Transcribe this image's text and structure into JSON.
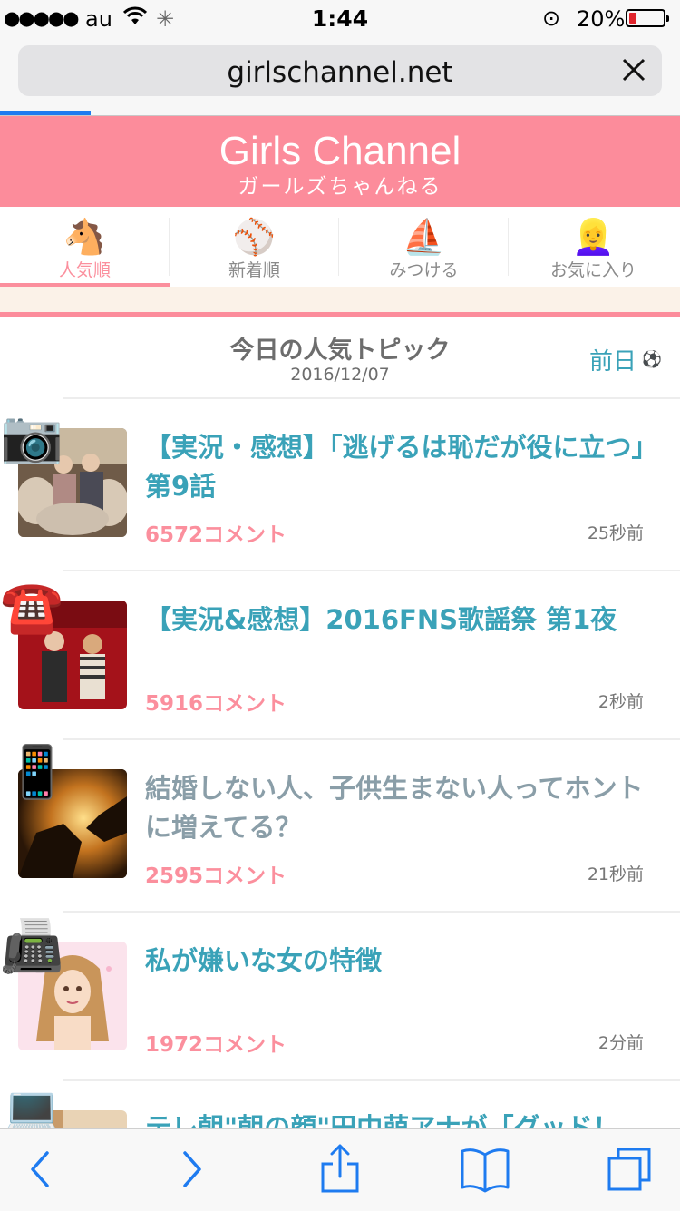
{
  "status": {
    "signal": "●●●●●",
    "carrier": "au",
    "spinner": "✳",
    "time": "1:44",
    "lock": "⊙",
    "battery": "20%"
  },
  "browser": {
    "url": "girlschannel.net"
  },
  "site": {
    "logo": "Girls Channel",
    "logo_sub": "ガールズちゃんねる",
    "brand_color": "#fc8c9b"
  },
  "tabs": [
    {
      "icon": "🐴",
      "label": "人気順",
      "active": true
    },
    {
      "icon": "⚾",
      "label": "新着順"
    },
    {
      "icon": "⛵",
      "label": "みつける"
    },
    {
      "icon": "👱‍♀️",
      "label": "お気に入り"
    }
  ],
  "section": {
    "title": "今日の人気トピック",
    "date": "2016/12/07",
    "prev_label": "前日",
    "prev_icon": "⚽"
  },
  "topics": [
    {
      "badge": "📷",
      "title": "【実況・感想】「逃げるは恥だが役に立つ」第9話",
      "comments": "6572コメント",
      "ago": "25秒前",
      "visited": false
    },
    {
      "badge": "☎️",
      "title": "【実況&感想】2016FNS歌謡祭 第1夜",
      "comments": "5916コメント",
      "ago": "2秒前",
      "visited": false
    },
    {
      "badge": "📱",
      "title": "結婚しない人、子供生まない人ってホントに増えてる？",
      "comments": "2595コメント",
      "ago": "21秒前",
      "visited": true
    },
    {
      "badge": "📠",
      "title": "私が嫌いな女の特徴",
      "comments": "1972コメント",
      "ago": "2分前",
      "visited": false
    },
    {
      "badge": "💻",
      "title": "テレ朝\"朝の顔\"田中萌アナが「グッド！",
      "comments": "",
      "ago": "",
      "visited": false
    }
  ],
  "toolbar": {
    "back": "back-icon",
    "forward": "forward-icon",
    "share": "share-icon",
    "bookmarks": "bookmarks-icon",
    "tabs": "tabs-icon"
  }
}
